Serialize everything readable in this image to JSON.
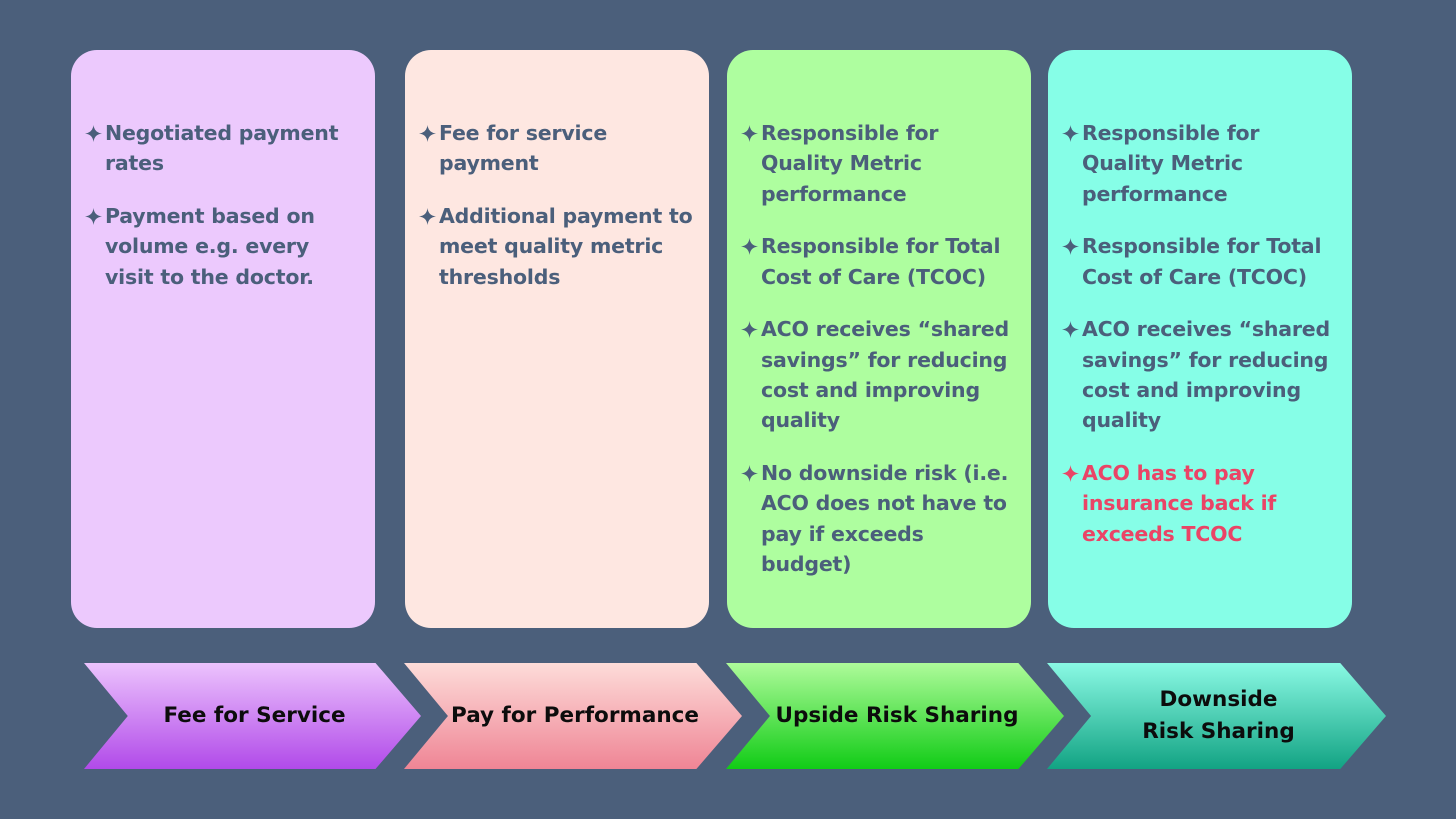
{
  "colors": {
    "background": "#4b5f7b",
    "text": "#4b5f7b",
    "alert_text": "#ea4466"
  },
  "columns": [
    {
      "card_color": "#ecc9fd",
      "bullets": [
        {
          "icon": "four-point-star-icon",
          "text": "Negotiated payment rates",
          "alert": false
        },
        {
          "icon": "four-point-star-icon",
          "text": "Payment based on volume e.g. every visit to the doctor.",
          "alert": false
        }
      ],
      "stage": {
        "label": "Fee for Service",
        "gradient": [
          "#ecc3fd",
          "#b14ae9"
        ]
      }
    },
    {
      "card_color": "#fee7e1",
      "bullets": [
        {
          "icon": "four-point-star-icon",
          "text": "Fee for service payment",
          "alert": false
        },
        {
          "icon": "four-point-star-icon",
          "text": "Additional payment to meet quality metric thresholds",
          "alert": false
        }
      ],
      "stage": {
        "label": "Pay for Performance",
        "gradient": [
          "#fddcd9",
          "#ef8595"
        ]
      }
    },
    {
      "card_color": "#aefe9f",
      "bullets": [
        {
          "icon": "four-point-star-icon",
          "text": "Responsible for Quality Metric performance",
          "alert": false
        },
        {
          "icon": "four-point-star-icon",
          "text": "Responsible for Total Cost of Care (TCOC)",
          "alert": false
        },
        {
          "icon": "four-point-star-icon",
          "text": "ACO receives “shared savings” for reducing cost and improving quality",
          "alert": false
        },
        {
          "icon": "four-point-star-icon",
          "text": "No downside risk (i.e. ACO does not have to pay if exceeds budget)",
          "alert": false
        }
      ],
      "stage": {
        "label": "Upside Risk Sharing",
        "gradient": [
          "#aefb9a",
          "#11cc16"
        ]
      }
    },
    {
      "card_color": "#86fee7",
      "bullets": [
        {
          "icon": "four-point-star-icon",
          "text": "Responsible for Quality Metric performance",
          "alert": false
        },
        {
          "icon": "four-point-star-icon",
          "text": "Responsible for Total Cost of Care (TCOC)",
          "alert": false
        },
        {
          "icon": "four-point-star-icon",
          "text": "ACO receives “shared savings” for reducing cost and improving quality",
          "alert": false
        },
        {
          "icon": "four-point-star-icon",
          "text": "ACO has to pay insurance back if exceeds TCOC",
          "alert": true
        }
      ],
      "stage": {
        "label": "Downside Risk Sharing",
        "gradient": [
          "#8af9e4",
          "#12a383"
        ]
      }
    }
  ]
}
